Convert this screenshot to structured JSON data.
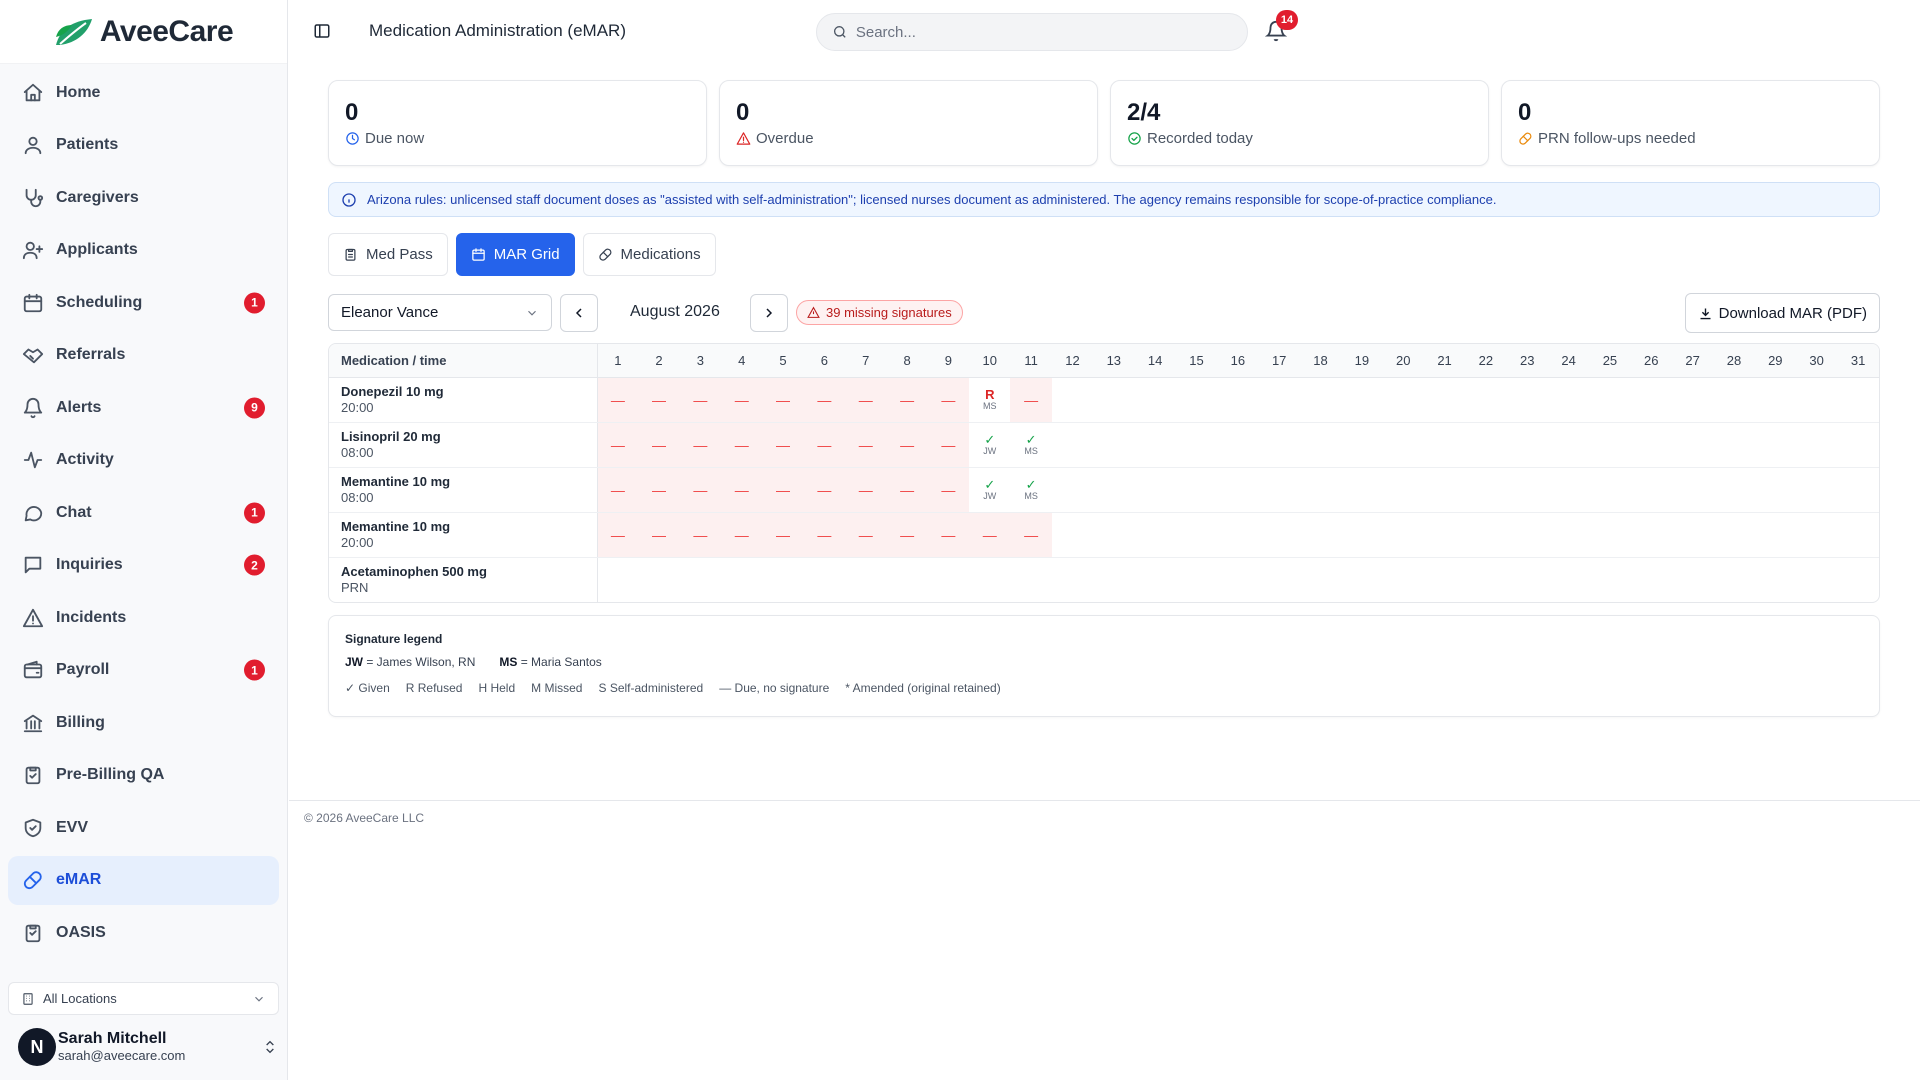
{
  "app": {
    "name": "AveeCare"
  },
  "sidebar": {
    "items": [
      {
        "label": "Home",
        "icon": "home-icon"
      },
      {
        "label": "Patients",
        "icon": "user-icon"
      },
      {
        "label": "Caregivers",
        "icon": "stethoscope-icon"
      },
      {
        "label": "Applicants",
        "icon": "user-plus-icon"
      },
      {
        "label": "Scheduling",
        "icon": "calendar-icon",
        "badge": "1"
      },
      {
        "label": "Referrals",
        "icon": "handshake-icon"
      },
      {
        "label": "Alerts",
        "icon": "bell-icon",
        "badge": "9"
      },
      {
        "label": "Activity",
        "icon": "activity-icon"
      },
      {
        "label": "Chat",
        "icon": "message-circle-icon",
        "badge": "1"
      },
      {
        "label": "Inquiries",
        "icon": "message-square-icon",
        "badge": "2"
      },
      {
        "label": "Incidents",
        "icon": "alert-triangle-icon"
      },
      {
        "label": "Payroll",
        "icon": "wallet-icon",
        "badge": "1"
      },
      {
        "label": "Billing",
        "icon": "bank-icon"
      },
      {
        "label": "Pre-Billing QA",
        "icon": "clipboard-check-icon"
      },
      {
        "label": "EVV",
        "icon": "shield-check-icon"
      },
      {
        "label": "eMAR",
        "icon": "pill-icon",
        "active": true
      },
      {
        "label": "OASIS",
        "icon": "clipboard-list-icon"
      }
    ],
    "location": "All Locations",
    "user": {
      "initial": "N",
      "name": "Sarah Mitchell",
      "email": "sarah@aveecare.com"
    }
  },
  "header": {
    "title": "Medication Administration (eMAR)",
    "search_placeholder": "Search...",
    "notification_count": "14"
  },
  "stats": [
    {
      "value": "0",
      "label": "Due now",
      "icon": "clock-icon",
      "color": "#2563eb"
    },
    {
      "value": "0",
      "label": "Overdue",
      "icon": "alert-triangle-icon",
      "color": "#dc2626"
    },
    {
      "value": "2/4",
      "label": "Recorded today",
      "icon": "check-circle-icon",
      "color": "#16a34a"
    },
    {
      "value": "0",
      "label": "PRN follow-ups needed",
      "icon": "pill-icon",
      "color": "#ea8a0c"
    }
  ],
  "banner": "Arizona rules: unlicensed staff document doses as \"assisted with self-administration\"; licensed nurses document as administered. The agency remains responsible for scope-of-practice compliance.",
  "tabs": [
    {
      "label": "Med Pass",
      "icon": "clipboard-icon"
    },
    {
      "label": "MAR Grid",
      "icon": "calendar-icon",
      "active": true
    },
    {
      "label": "Medications",
      "icon": "pill-icon"
    }
  ],
  "controls": {
    "patient": "Eleanor Vance",
    "month": "August 2026",
    "missing": "39 missing signatures",
    "download": "Download MAR (PDF)"
  },
  "grid": {
    "header_label": "Medication / time",
    "days": 31,
    "rows": [
      {
        "name": "Donepezil 10 mg",
        "time": "20:00",
        "cells": {
          "1": "missed",
          "2": "missed",
          "3": "missed",
          "4": "missed",
          "5": "missed",
          "6": "missed",
          "7": "missed",
          "8": "missed",
          "9": "missed",
          "10": "R|MS",
          "11": "missed"
        }
      },
      {
        "name": "Lisinopril 20 mg",
        "time": "08:00",
        "cells": {
          "1": "missed",
          "2": "missed",
          "3": "missed",
          "4": "missed",
          "5": "missed",
          "6": "missed",
          "7": "missed",
          "8": "missed",
          "9": "missed",
          "10": "✓|JW",
          "11": "✓|MS"
        }
      },
      {
        "name": "Memantine 10 mg",
        "time": "08:00",
        "cells": {
          "1": "missed",
          "2": "missed",
          "3": "missed",
          "4": "missed",
          "5": "missed",
          "6": "missed",
          "7": "missed",
          "8": "missed",
          "9": "missed",
          "10": "✓|JW",
          "11": "✓|MS"
        }
      },
      {
        "name": "Memantine 10 mg",
        "time": "20:00",
        "cells": {
          "1": "missed",
          "2": "missed",
          "3": "missed",
          "4": "missed",
          "5": "missed",
          "6": "missed",
          "7": "missed",
          "8": "missed",
          "9": "missed",
          "10": "missed",
          "11": "missed"
        }
      },
      {
        "name": "Acetaminophen 500 mg",
        "time": "PRN",
        "cells": {}
      }
    ],
    "missed_symbol": "—"
  },
  "legend": {
    "title": "Signature legend",
    "signatures": [
      {
        "code": "JW",
        "name": "= James Wilson, RN"
      },
      {
        "code": "MS",
        "name": "= Maria Santos"
      }
    ],
    "keys": [
      "✓ Given",
      "R Refused",
      "H Held",
      "M Missed",
      "S Self-administered",
      "— Due, no signature",
      "* Amended (original retained)"
    ]
  },
  "footer": "© 2026 AveeCare LLC"
}
